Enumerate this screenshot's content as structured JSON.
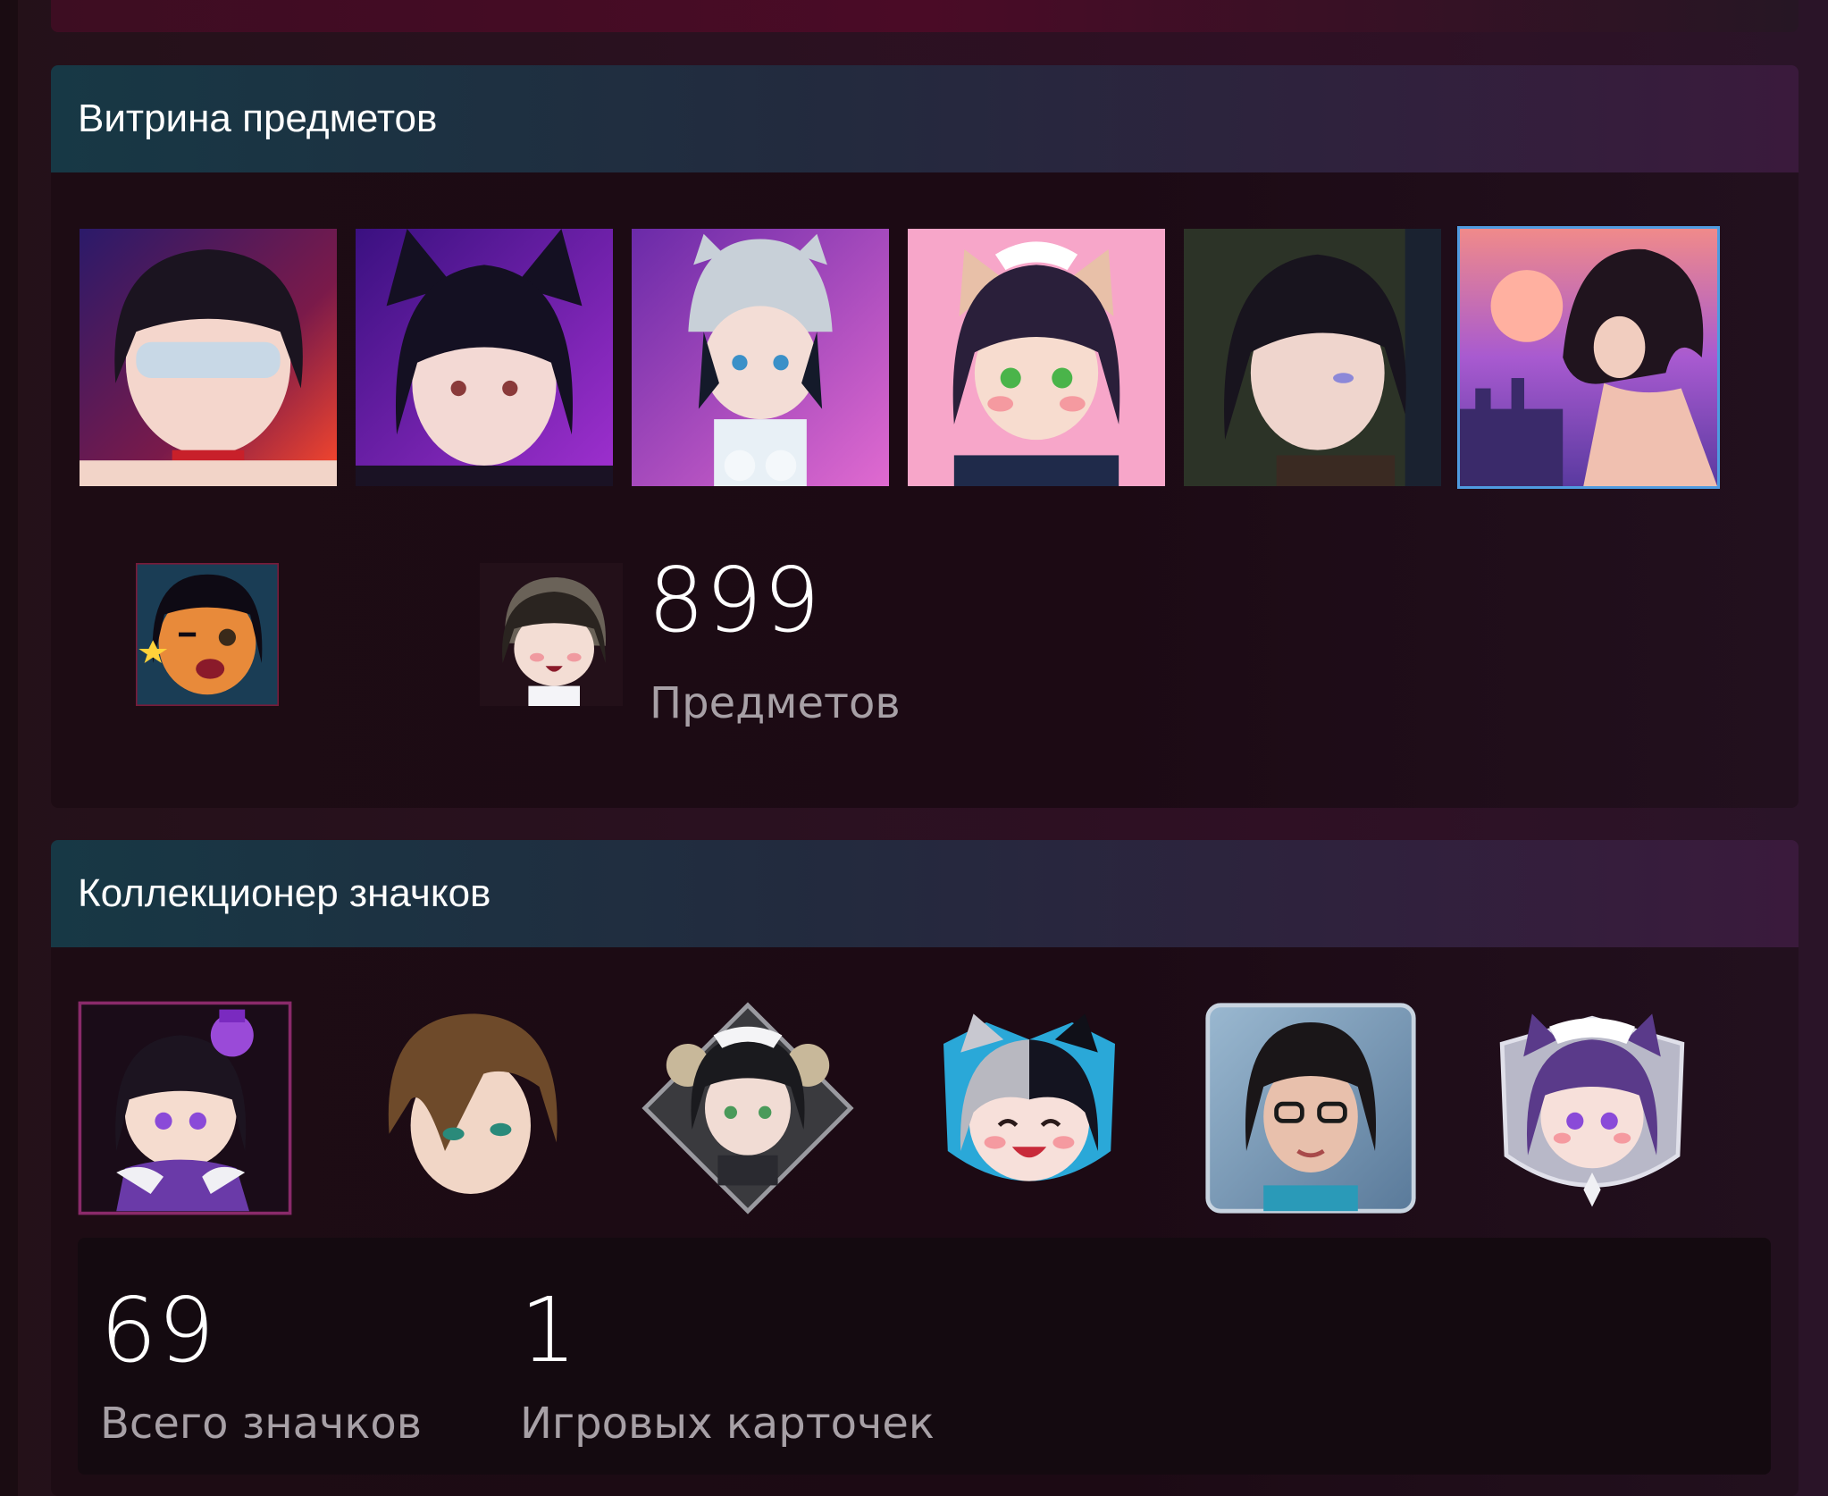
{
  "showcase": {
    "title": "Витрина предметов",
    "item_count": "899",
    "item_count_label": "Предметов",
    "items": [
      {
        "name": "blindfold-girl-avatar",
        "bg": "#3a1a60",
        "accent": "#ff3b6b"
      },
      {
        "name": "fox-ear-girl-avatar",
        "bg": "#6a1ea8",
        "accent": "#ff8ad8"
      },
      {
        "name": "cat-beanie-girl-avatar",
        "bg": "#c45ad0",
        "accent": "#7fd0ff"
      },
      {
        "name": "maid-catgirl-avatar",
        "bg": "#f7a6c9",
        "accent": "#52c45a"
      },
      {
        "name": "dark-hair-girl-avatar",
        "bg": "#2c3327",
        "accent": "#9090e0"
      },
      {
        "name": "sunset-city-girl-avatar",
        "bg": "#8d4bbf",
        "accent": "#ff9c7a"
      }
    ],
    "emotes": [
      {
        "name": "winking-girl-emote",
        "bg": "#1a3d55"
      },
      {
        "name": "crying-chibi-emote",
        "bg": "#2a1622"
      }
    ]
  },
  "collector": {
    "title": "Коллекционер значков",
    "badges": [
      {
        "name": "chibi-queen-badge"
      },
      {
        "name": "brown-hair-girl-badge"
      },
      {
        "name": "ram-horn-maid-badge"
      },
      {
        "name": "two-tone-catgirl-badge"
      },
      {
        "name": "glasses-woman-badge"
      },
      {
        "name": "purple-maid-badge"
      }
    ],
    "total_badges": "69",
    "total_badges_label": "Всего значков",
    "game_cards": "1",
    "game_cards_label": "Игровых карточек"
  },
  "colors": {
    "header_start": "#173845",
    "header_end": "#3a1a3c",
    "selected_outline": "#4f9be0",
    "label_gray": "#a7a0a6"
  }
}
